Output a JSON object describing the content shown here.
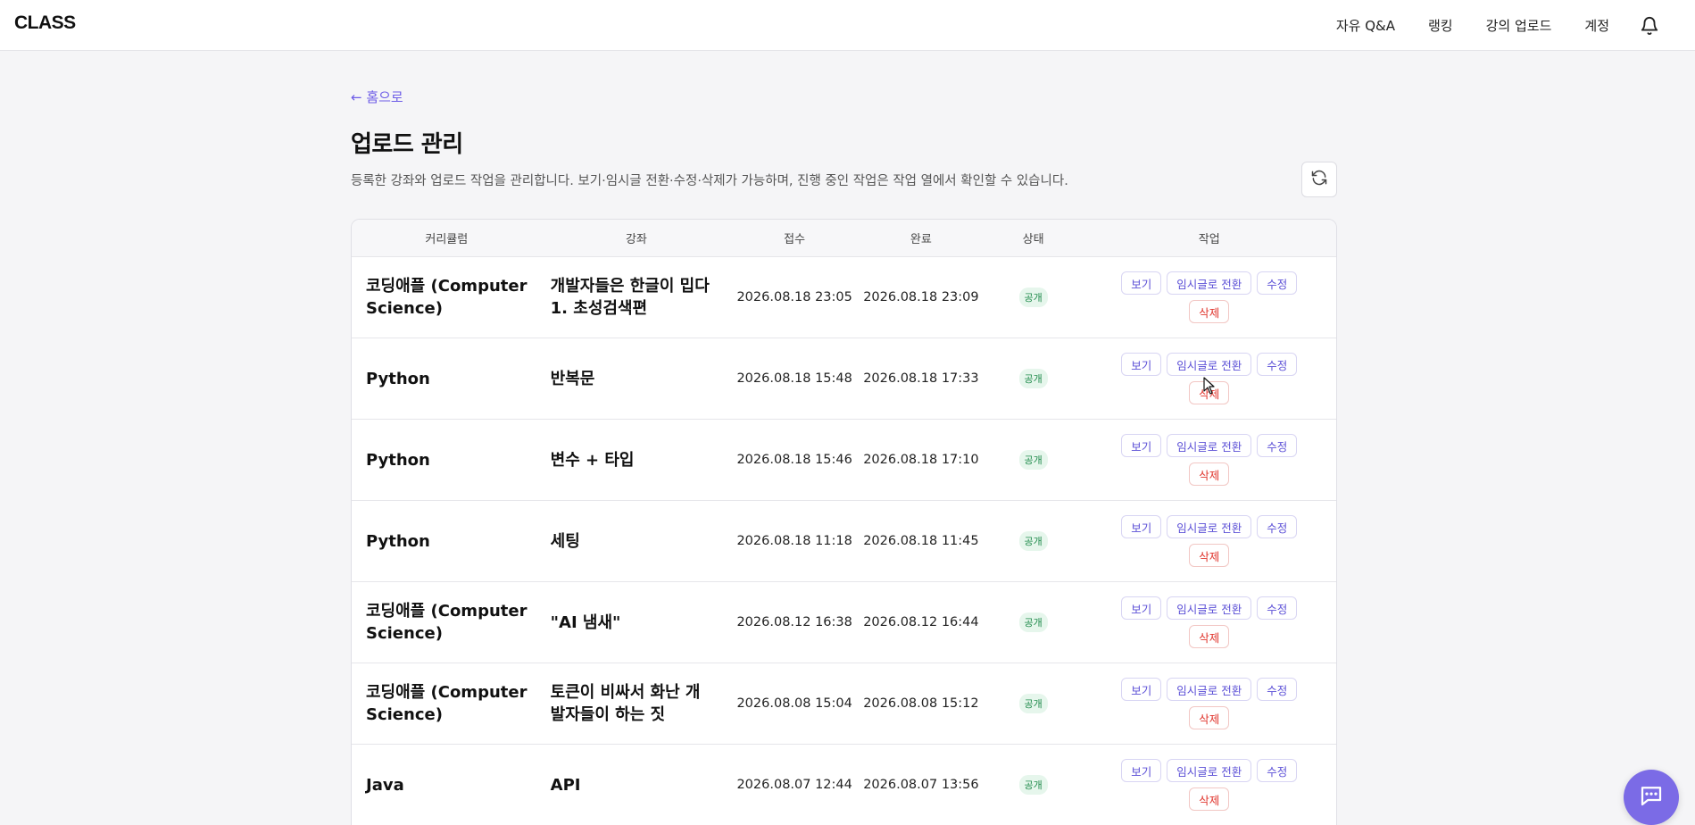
{
  "header": {
    "logo": "CLASS",
    "nav": [
      "자유 Q&A",
      "랭킹",
      "강의 업로드",
      "계정"
    ],
    "bell_icon": "bell-icon"
  },
  "page": {
    "back_link": "← 홈으로",
    "title": "업로드 관리",
    "description": "등록한 강좌와 업로드 작업을 관리합니다. 보기·임시글 전환·수정·삭제가 가능하며, 진행 중인 작업은 작업 열에서 확인할 수 있습니다.",
    "refresh_icon": "refresh-icon"
  },
  "table": {
    "headers": [
      "커리큘럼",
      "강좌",
      "접수",
      "완료",
      "상태",
      "작업"
    ],
    "actions": {
      "view": "보기",
      "draft": "임시글로 전환",
      "edit": "수정",
      "delete": "삭제"
    },
    "rows": [
      {
        "curriculum": "코딩애플 (Computer Science)",
        "lecture": "개발자들은 한글이 밉다 1. 초성검색편",
        "received": "2026.08.18 23:05",
        "completed": "2026.08.18 23:09",
        "status": "공개"
      },
      {
        "curriculum": "Python",
        "lecture": "반복문",
        "received": "2026.08.18 15:48",
        "completed": "2026.08.18 17:33",
        "status": "공개"
      },
      {
        "curriculum": "Python",
        "lecture": "변수 + 타입",
        "received": "2026.08.18 15:46",
        "completed": "2026.08.18 17:10",
        "status": "공개"
      },
      {
        "curriculum": "Python",
        "lecture": "세팅",
        "received": "2026.08.18 11:18",
        "completed": "2026.08.18 11:45",
        "status": "공개"
      },
      {
        "curriculum": "코딩애플 (Computer Science)",
        "lecture": "\"AI 냄새\"",
        "received": "2026.08.12 16:38",
        "completed": "2026.08.12 16:44",
        "status": "공개"
      },
      {
        "curriculum": "코딩애플 (Computer Science)",
        "lecture": "토큰이 비싸서 화난 개발자들이 하는 짓",
        "received": "2026.08.08 15:04",
        "completed": "2026.08.08 15:12",
        "status": "공개"
      },
      {
        "curriculum": "Java",
        "lecture": "API",
        "received": "2026.08.07 12:44",
        "completed": "2026.08.07 13:56",
        "status": "공개"
      }
    ]
  },
  "chat_icon": "chat-icon",
  "colors": {
    "accent": "#6d5ce7",
    "danger": "#e0342c",
    "status_public": "#1e8a4a"
  }
}
